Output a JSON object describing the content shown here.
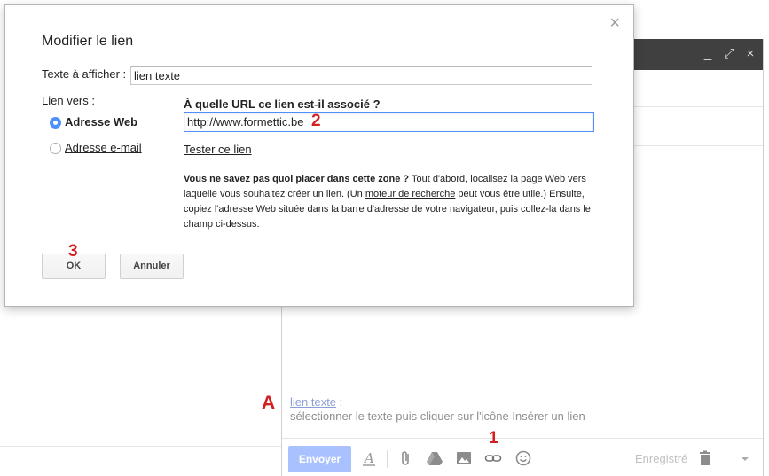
{
  "dialog": {
    "title": "Modifier le lien",
    "close_glyph": "×",
    "display_text_label": "Texte à afficher :",
    "display_text_value": "lien texte",
    "link_to_label": "Lien vers :",
    "option_web": "Adresse Web",
    "option_email": "Adresse e-mail",
    "url_question": "À quelle URL ce lien est-il associé ?",
    "url_value": "http://www.formettic.be",
    "test_link": "Tester ce lien",
    "help": {
      "bold_intro": "Vous ne savez pas quoi placer dans cette zone ?",
      "part1": " Tout d'abord, localisez la page Web vers laquelle vous souhaitez créer un lien. (Un ",
      "search_link": "moteur de recherche",
      "part2": " peut vous être utile.) Ensuite, copiez l'adresse Web située dans la barre d'adresse de votre navigateur, puis collez-la dans le champ ci-dessus."
    },
    "ok_label": "OK",
    "cancel_label": "Annuler",
    "selected_option": "web"
  },
  "compose": {
    "window_buttons": [
      "_",
      "⤢",
      "×"
    ],
    "link_sample": "lien texte",
    "link_sample_suffix": " :",
    "instruction": "sélectionner le texte puis cliquer sur l'icône Insérer un lien",
    "send_label": "Envoyer",
    "saved_label": "Enregistré",
    "icons": [
      "format-text-icon",
      "attach-icon",
      "drive-icon",
      "photo-icon",
      "insert-link-icon",
      "emoji-icon",
      "trash-icon",
      "more-options-icon"
    ]
  },
  "markers": {
    "m1": "1",
    "m2": "2",
    "m3": "3",
    "mA": "A"
  },
  "colors": {
    "accent_blue": "#4d90fe",
    "send_button": "#a9c1ff",
    "marker_red": "#d21f1f",
    "compose_header": "#404040"
  }
}
